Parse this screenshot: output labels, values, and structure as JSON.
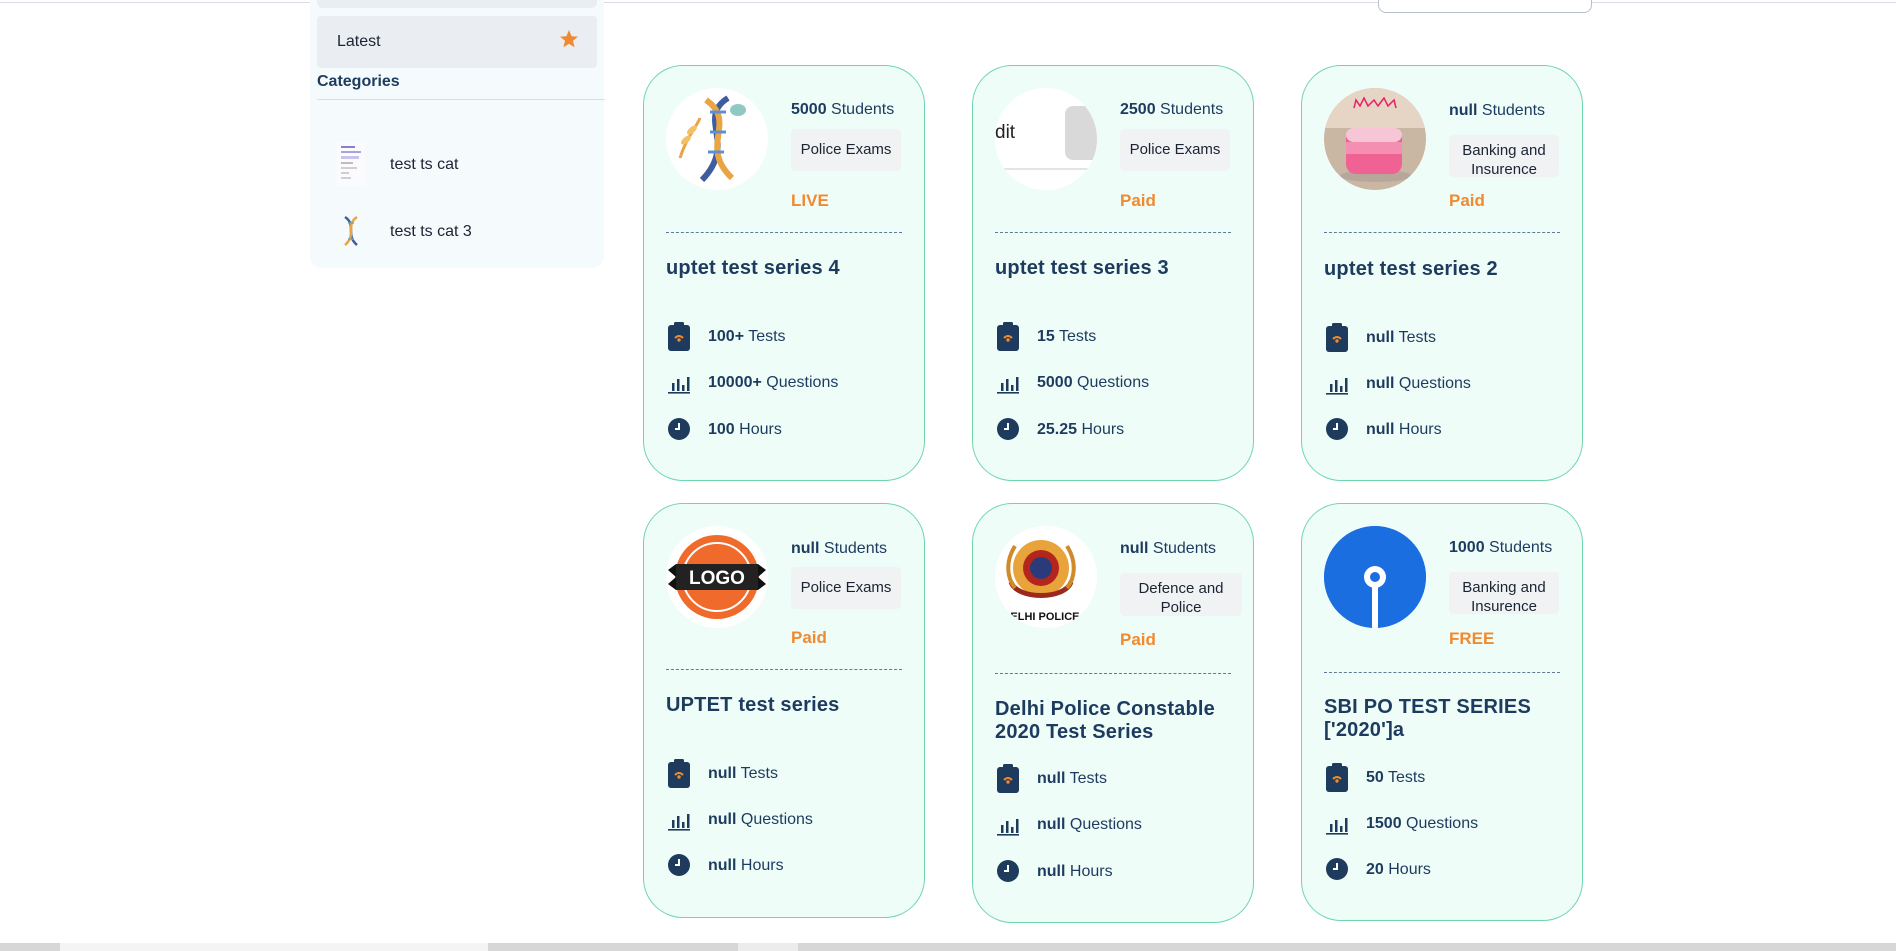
{
  "sidebar": {
    "latest_label": "Latest",
    "categories_title": "Categories",
    "categories": [
      {
        "label": "test ts cat"
      },
      {
        "label": "test ts cat 3"
      }
    ]
  },
  "colors": {
    "card_bg": "#effdf9",
    "card_border": "#6fd6ab",
    "badge": "#f08a31",
    "text_dark": "#1d3b5f"
  },
  "cards": [
    {
      "students": "5000",
      "students_label": "Students",
      "category": "Police Exams",
      "badge": "LIVE",
      "title": "uptet test series 4",
      "tests": "100+",
      "tests_label": "Tests",
      "questions": "10000+",
      "questions_label": "Questions",
      "hours": "100",
      "hours_label": "Hours",
      "logo": "dna-logo"
    },
    {
      "students": "2500",
      "students_label": "Students",
      "category": "Police Exams",
      "badge": "Paid",
      "title": "uptet test series 3",
      "tests": "15",
      "tests_label": "Tests",
      "questions": "5000",
      "questions_label": "Questions",
      "hours": "25.25",
      "hours_label": "Hours",
      "logo": "edit-screenshot-logo",
      "logo_text": "dit"
    },
    {
      "students": "null",
      "students_label": "Students",
      "category": "Banking and Insurence",
      "badge": "Paid",
      "title": "uptet test series 2",
      "tests": "null",
      "tests_label": "Tests",
      "questions": "null",
      "questions_label": "Questions",
      "hours": "null",
      "hours_label": "Hours",
      "logo": "cake-logo"
    },
    {
      "students": "null",
      "students_label": "Students",
      "category": "Police Exams",
      "badge": "Paid",
      "title": "UPTET test series",
      "tests": "null",
      "tests_label": "Tests",
      "questions": "null",
      "questions_label": "Questions",
      "hours": "null",
      "hours_label": "Hours",
      "logo": "logo-badge",
      "logo_text": "LOGO"
    },
    {
      "students": "null",
      "students_label": "Students",
      "category": "Defence and Police",
      "badge": "Paid",
      "title": "Delhi Police Constable 2020 Test Series",
      "tests": "null",
      "tests_label": "Tests",
      "questions": "null",
      "questions_label": "Questions",
      "hours": "null",
      "hours_label": "Hours",
      "logo": "delhi-police-emblem",
      "logo_text": "DELHI POLICE"
    },
    {
      "students": "1000",
      "students_label": "Students",
      "category": "Banking and Insurence",
      "badge": "FREE",
      "title": "SBI PO TEST SERIES ['2020']a",
      "tests": "50",
      "tests_label": "Tests",
      "questions": "1500",
      "questions_label": "Questions",
      "hours": "20",
      "hours_label": "Hours",
      "logo": "sbi-logo"
    }
  ]
}
